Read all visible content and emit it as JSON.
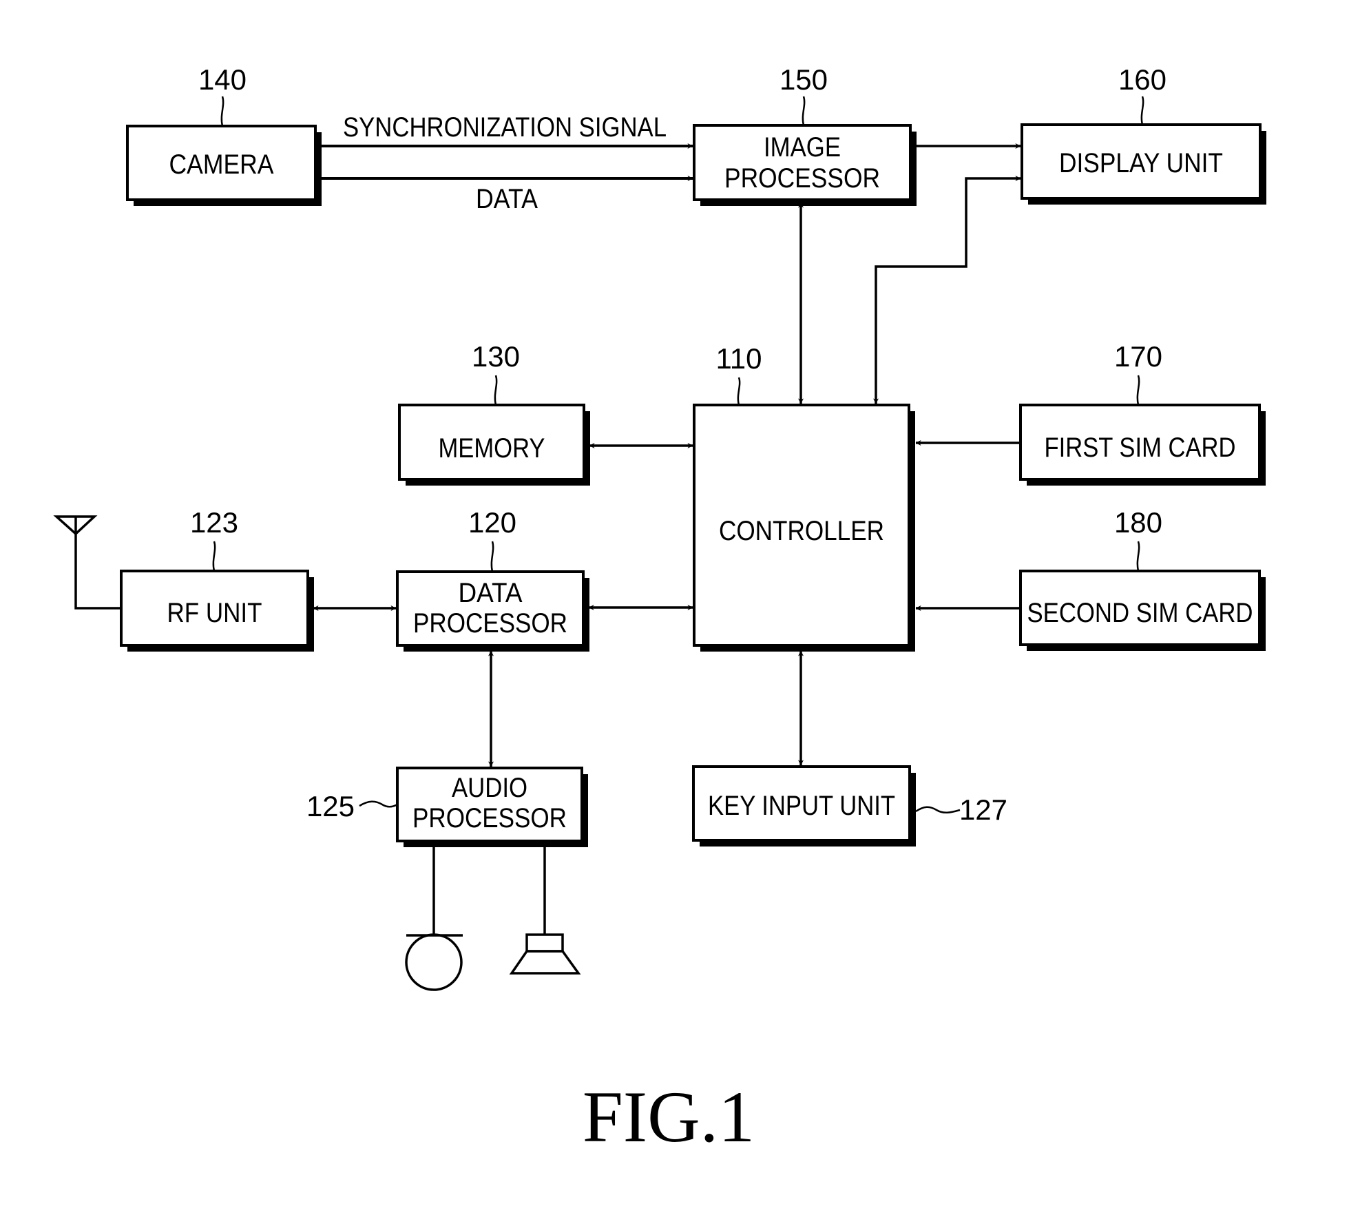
{
  "figure": {
    "caption": "FIG.1"
  },
  "blocks": {
    "camera": {
      "ref": "140",
      "lines": [
        "CAMERA"
      ]
    },
    "image_processor": {
      "ref": "150",
      "lines": [
        "IMAGE",
        "PROCESSOR"
      ]
    },
    "display_unit": {
      "ref": "160",
      "lines": [
        "DISPLAY UNIT"
      ]
    },
    "memory": {
      "ref": "130",
      "lines": [
        "MEMORY"
      ]
    },
    "controller": {
      "ref": "110",
      "lines": [
        "CONTROLLER"
      ]
    },
    "first_sim_card": {
      "ref": "170",
      "lines": [
        "FIRST SIM CARD"
      ]
    },
    "second_sim_card": {
      "ref": "180",
      "lines": [
        "SECOND SIM CARD"
      ]
    },
    "rf_unit": {
      "ref": "123",
      "lines": [
        "RF UNIT"
      ]
    },
    "data_processor": {
      "ref": "120",
      "lines": [
        "DATA",
        "PROCESSOR"
      ]
    },
    "audio_processor": {
      "ref": "125",
      "lines": [
        "AUDIO",
        "PROCESSOR"
      ]
    },
    "key_input_unit": {
      "ref": "127",
      "lines": [
        "KEY INPUT UNIT"
      ]
    }
  },
  "signals": {
    "sync": "SYNCHRONIZATION SIGNAL",
    "data": "DATA"
  },
  "connections": [
    {
      "from": "camera",
      "to": "image_processor",
      "label": "SYNCHRONIZATION SIGNAL",
      "direction": "one-way"
    },
    {
      "from": "camera",
      "to": "image_processor",
      "label": "DATA",
      "direction": "one-way"
    },
    {
      "from": "image_processor",
      "to": "display_unit",
      "direction": "one-way"
    },
    {
      "from": "controller",
      "to": "display_unit",
      "direction": "one-way"
    },
    {
      "from": "image_processor",
      "to": "controller",
      "direction": "two-way"
    },
    {
      "from": "memory",
      "to": "controller",
      "direction": "two-way"
    },
    {
      "from": "first_sim_card",
      "to": "controller",
      "direction": "one-way"
    },
    {
      "from": "second_sim_card",
      "to": "controller",
      "direction": "one-way"
    },
    {
      "from": "rf_unit",
      "to": "data_processor",
      "direction": "two-way"
    },
    {
      "from": "data_processor",
      "to": "controller",
      "direction": "two-way"
    },
    {
      "from": "data_processor",
      "to": "audio_processor",
      "direction": "two-way"
    },
    {
      "from": "controller",
      "to": "key_input_unit",
      "direction": "two-way"
    }
  ],
  "peripherals": {
    "antenna": "antenna-icon",
    "microphone": "microphone-icon",
    "speaker": "speaker-icon"
  }
}
